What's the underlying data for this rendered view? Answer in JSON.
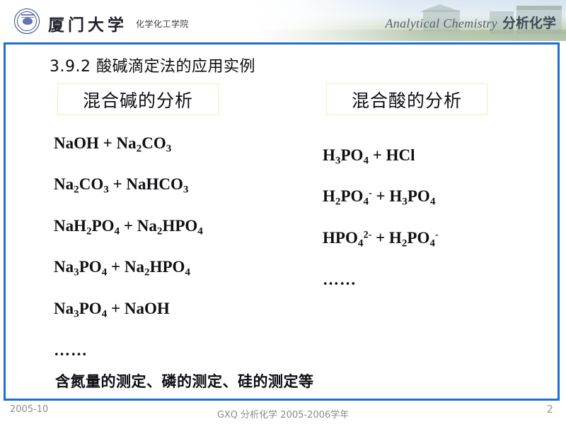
{
  "header": {
    "logo_name": "xiamen-university-seal",
    "university_name": "厦门大学",
    "school_name": "化学化工学院",
    "course_en": "Analytical Chemistry",
    "course_cn": "分析化学"
  },
  "slide": {
    "title": "3.9.2  酸碱滴定法的应用实例",
    "bottom_note": "含氮量的测定、磷的测定、硅的测定等"
  },
  "columns": [
    {
      "heading": "混合碱的分析",
      "items": [
        {
          "html": "NaOH + Na<sub>2</sub>CO<sub>3</sub>",
          "text": "NaOH + Na2CO3"
        },
        {
          "html": "Na<sub>2</sub>CO<sub>3</sub> + NaHCO<sub>3</sub>",
          "text": "Na2CO3 + NaHCO3"
        },
        {
          "html": "NaH<sub>2</sub>PO<sub>4</sub> + Na<sub>2</sub>HPO<sub>4</sub>",
          "text": "NaH2PO4 + Na2HPO4"
        },
        {
          "html": "Na<sub>3</sub>PO<sub>4</sub> + Na<sub>2</sub>HPO<sub>4</sub>",
          "text": "Na3PO4 + Na2HPO4"
        },
        {
          "html": "Na<sub>3</sub>PO<sub>4</sub> + NaOH",
          "text": "Na3PO4 + NaOH"
        },
        {
          "html": "……",
          "text": "……"
        }
      ]
    },
    {
      "heading": "混合酸的分析",
      "items": [
        {
          "html": "H<sub>3</sub>PO<sub>4</sub> + HCl",
          "text": "H3PO4 + HCl"
        },
        {
          "html": "H<sub>2</sub>PO<sub>4</sub><sup>-</sup> + H<sub>3</sub>PO<sub>4</sub>",
          "text": "H2PO4- + H3PO4"
        },
        {
          "html": "HPO<sub>4</sub><sup>2-</sup> + H<sub>2</sub>PO<sub>4</sub><sup>-</sup>",
          "text": "HPO42- + H2PO4-"
        },
        {
          "html": "……",
          "text": "……"
        }
      ]
    }
  ],
  "footer": {
    "date": "2005-10",
    "center": "GXQ  分析化学  2005-2006学年",
    "page_number": "2"
  },
  "colors": {
    "frame_blue": "#1f6fd0",
    "box_border": "#f2edb4",
    "footer_gray": "#8b8b8b",
    "text_black": "#0d0d12"
  }
}
